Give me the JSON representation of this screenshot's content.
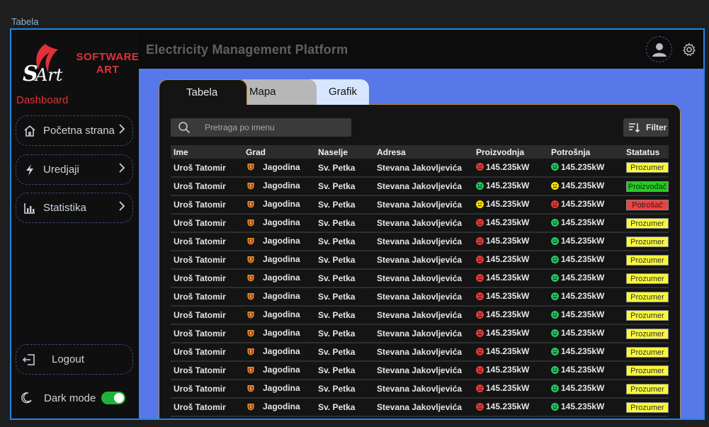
{
  "frame_label": "Tabela",
  "logo": {
    "line1": "SOFTWARE",
    "line2": "ART"
  },
  "sidebar": {
    "section_label": "Dashboard",
    "items": [
      {
        "label": "Početna strana",
        "icon": "home-icon"
      },
      {
        "label": "Uredjaji",
        "icon": "bolt-icon"
      },
      {
        "label": "Statistika",
        "icon": "chart-icon"
      }
    ],
    "logout_label": "Logout",
    "darkmode_label": "Dark mode",
    "darkmode_on": true
  },
  "header": {
    "title": "Electricity Management Platform"
  },
  "tabs": [
    {
      "label": "Tabela",
      "active": true
    },
    {
      "label": "Mapa",
      "active": false
    },
    {
      "label": "Grafik",
      "active": false
    }
  ],
  "search": {
    "placeholder": "Pretraga po imenu"
  },
  "filter": {
    "label": "Filter"
  },
  "colors": {
    "accent_red": "#e0313a",
    "main_blue": "#5678e8",
    "face_green": "#22c55e",
    "face_yellow": "#f5e000",
    "face_red": "#e53935",
    "badge_prozumer": "#f8f83a",
    "badge_proizvodac": "#1fd11f",
    "badge_potrosac": "#f04040"
  },
  "table": {
    "columns": [
      "Ime",
      "Grad",
      "Naselje",
      "Adresa",
      "Proizvodnja",
      "Potrošnja",
      "Statatus"
    ],
    "rows": [
      {
        "ime": "Uroš Tatomir",
        "grad": "Jagodina",
        "naselje": "Sv. Petka",
        "adresa": "Stevana Jakovljevića",
        "proizvodnja": "145.235kW",
        "proizvodnja_face": "red",
        "potrosnja": "145.235kW",
        "potrosnja_face": "green",
        "status": "Prozumer",
        "status_type": "prozumer"
      },
      {
        "ime": "Uroš Tatomir",
        "grad": "Jagodina",
        "naselje": "Sv. Petka",
        "adresa": "Stevana Jakovljevića",
        "proizvodnja": "145.235kW",
        "proizvodnja_face": "green",
        "potrosnja": "145.235kW",
        "potrosnja_face": "yellow",
        "status": "Proizvođač",
        "status_type": "proizvodac"
      },
      {
        "ime": "Uroš Tatomir",
        "grad": "Jagodina",
        "naselje": "Sv. Petka",
        "adresa": "Stevana Jakovljevića",
        "proizvodnja": "145.235kW",
        "proizvodnja_face": "yellow",
        "potrosnja": "145.235kW",
        "potrosnja_face": "red",
        "status": "Potrošač",
        "status_type": "potrosac"
      },
      {
        "ime": "Uroš Tatomir",
        "grad": "Jagodina",
        "naselje": "Sv. Petka",
        "adresa": "Stevana Jakovljevića",
        "proizvodnja": "145.235kW",
        "proizvodnja_face": "red",
        "potrosnja": "145.235kW",
        "potrosnja_face": "green",
        "status": "Prozumer",
        "status_type": "prozumer"
      },
      {
        "ime": "Uroš Tatomir",
        "grad": "Jagodina",
        "naselje": "Sv. Petka",
        "adresa": "Stevana Jakovljevića",
        "proizvodnja": "145.235kW",
        "proizvodnja_face": "red",
        "potrosnja": "145.235kW",
        "potrosnja_face": "green",
        "status": "Prozumer",
        "status_type": "prozumer"
      },
      {
        "ime": "Uroš Tatomir",
        "grad": "Jagodina",
        "naselje": "Sv. Petka",
        "adresa": "Stevana Jakovljevića",
        "proizvodnja": "145.235kW",
        "proizvodnja_face": "red",
        "potrosnja": "145.235kW",
        "potrosnja_face": "green",
        "status": "Prozumer",
        "status_type": "prozumer"
      },
      {
        "ime": "Uroš Tatomir",
        "grad": "Jagodina",
        "naselje": "Sv. Petka",
        "adresa": "Stevana Jakovljevića",
        "proizvodnja": "145.235kW",
        "proizvodnja_face": "red",
        "potrosnja": "145.235kW",
        "potrosnja_face": "green",
        "status": "Prozumer",
        "status_type": "prozumer"
      },
      {
        "ime": "Uroš Tatomir",
        "grad": "Jagodina",
        "naselje": "Sv. Petka",
        "adresa": "Stevana Jakovljevića",
        "proizvodnja": "145.235kW",
        "proizvodnja_face": "red",
        "potrosnja": "145.235kW",
        "potrosnja_face": "green",
        "status": "Prozumer",
        "status_type": "prozumer"
      },
      {
        "ime": "Uroš Tatomir",
        "grad": "Jagodina",
        "naselje": "Sv. Petka",
        "adresa": "Stevana Jakovljevića",
        "proizvodnja": "145.235kW",
        "proizvodnja_face": "red",
        "potrosnja": "145.235kW",
        "potrosnja_face": "green",
        "status": "Prozumer",
        "status_type": "prozumer"
      },
      {
        "ime": "Uroš Tatomir",
        "grad": "Jagodina",
        "naselje": "Sv. Petka",
        "adresa": "Stevana Jakovljevića",
        "proizvodnja": "145.235kW",
        "proizvodnja_face": "red",
        "potrosnja": "145.235kW",
        "potrosnja_face": "green",
        "status": "Prozumer",
        "status_type": "prozumer"
      },
      {
        "ime": "Uroš Tatomir",
        "grad": "Jagodina",
        "naselje": "Sv. Petka",
        "adresa": "Stevana Jakovljevića",
        "proizvodnja": "145.235kW",
        "proizvodnja_face": "red",
        "potrosnja": "145.235kW",
        "potrosnja_face": "green",
        "status": "Prozumer",
        "status_type": "prozumer"
      },
      {
        "ime": "Uroš Tatomir",
        "grad": "Jagodina",
        "naselje": "Sv. Petka",
        "adresa": "Stevana Jakovljevića",
        "proizvodnja": "145.235kW",
        "proizvodnja_face": "red",
        "potrosnja": "145.235kW",
        "potrosnja_face": "green",
        "status": "Prozumer",
        "status_type": "prozumer"
      },
      {
        "ime": "Uroš Tatomir",
        "grad": "Jagodina",
        "naselje": "Sv. Petka",
        "adresa": "Stevana Jakovljevića",
        "proizvodnja": "145.235kW",
        "proizvodnja_face": "red",
        "potrosnja": "145.235kW",
        "potrosnja_face": "green",
        "status": "Prozumer",
        "status_type": "prozumer"
      },
      {
        "ime": "Uroš Tatomir",
        "grad": "Jagodina",
        "naselje": "Sv. Petka",
        "adresa": "Stevana Jakovljevića",
        "proizvodnja": "145.235kW",
        "proizvodnja_face": "red",
        "potrosnja": "145.235kW",
        "potrosnja_face": "green",
        "status": "Prozumer",
        "status_type": "prozumer"
      }
    ]
  }
}
